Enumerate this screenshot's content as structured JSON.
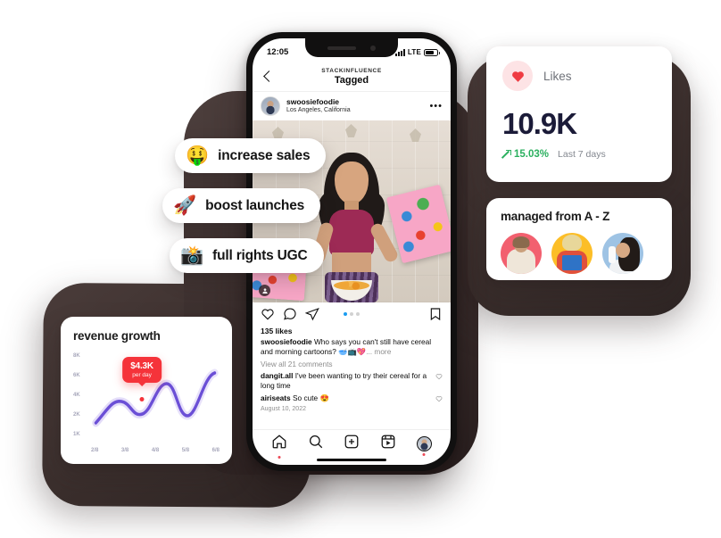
{
  "phone": {
    "status_bar": {
      "time": "12:05",
      "network": "LTE"
    },
    "header": {
      "brand": "STACKINFLUENCE",
      "title": "Tagged",
      "back_icon": "chevron-left-icon"
    },
    "post": {
      "username": "swoosiefoodie",
      "location": "Los Angeles, California",
      "more_icon": "ellipsis-icon",
      "likes": "135 likes",
      "caption_author": "swoosiefoodie",
      "caption_text": "Who says you can't still have cereal and morning cartoons?",
      "caption_emoji": "🥣📺💖",
      "caption_more": "... more",
      "view_comments": "View all 21 comments",
      "comments": [
        {
          "author": "dangit.all",
          "text": "I've been wanting to try their cereal for a long time"
        },
        {
          "author": "airiseats",
          "text": "So cute 😍"
        }
      ],
      "date": "August 10, 2022",
      "carousel_dots": 3,
      "carousel_active": 1,
      "actions": [
        "heart-icon",
        "comment-icon",
        "share-icon",
        "bookmark-icon"
      ]
    },
    "tabbar": [
      "home-icon",
      "search-icon",
      "create-icon",
      "reels-icon",
      "profile-avatar"
    ]
  },
  "pills": [
    {
      "emoji": "🤑",
      "label": "increase sales"
    },
    {
      "emoji": "🚀",
      "label": "boost launches"
    },
    {
      "emoji": "📸",
      "label": "full rights UGC"
    }
  ],
  "likes_card": {
    "icon": "heart-icon",
    "label": "Likes",
    "value": "10.9K",
    "delta": "15.03%",
    "period": "Last 7 days",
    "delta_color": "#2bb05f",
    "icon_color": "#ef3b42"
  },
  "managed_card": {
    "title": "managed from A - Z",
    "avatars": [
      "creator-avatar-1",
      "creator-avatar-2",
      "creator-avatar-3"
    ]
  },
  "revenue_card": {
    "title": "revenue growth",
    "tooltip_value": "$4.3K",
    "tooltip_sub": "per day",
    "line_color": "#6b4fd6"
  },
  "chart_data": {
    "type": "line",
    "title": "revenue growth",
    "xlabel": "",
    "ylabel": "",
    "x": [
      "2/8",
      "3/8",
      "4/8",
      "5/8",
      "6/8"
    ],
    "ytick_labels": [
      "8K",
      "6K",
      "4K",
      "2K",
      "1K"
    ],
    "ylim": [
      1000,
      8000
    ],
    "grid": false,
    "legend": false,
    "series": [
      {
        "name": "revenue",
        "values": [
          1500,
          2400,
          1900,
          2100,
          4300,
          2000,
          1800,
          5900,
          6300
        ]
      }
    ],
    "annotations": [
      {
        "label": "$4.3K",
        "sublabel": "per day",
        "x": "4/8",
        "y": 4300,
        "color": "#f5333a"
      }
    ]
  }
}
